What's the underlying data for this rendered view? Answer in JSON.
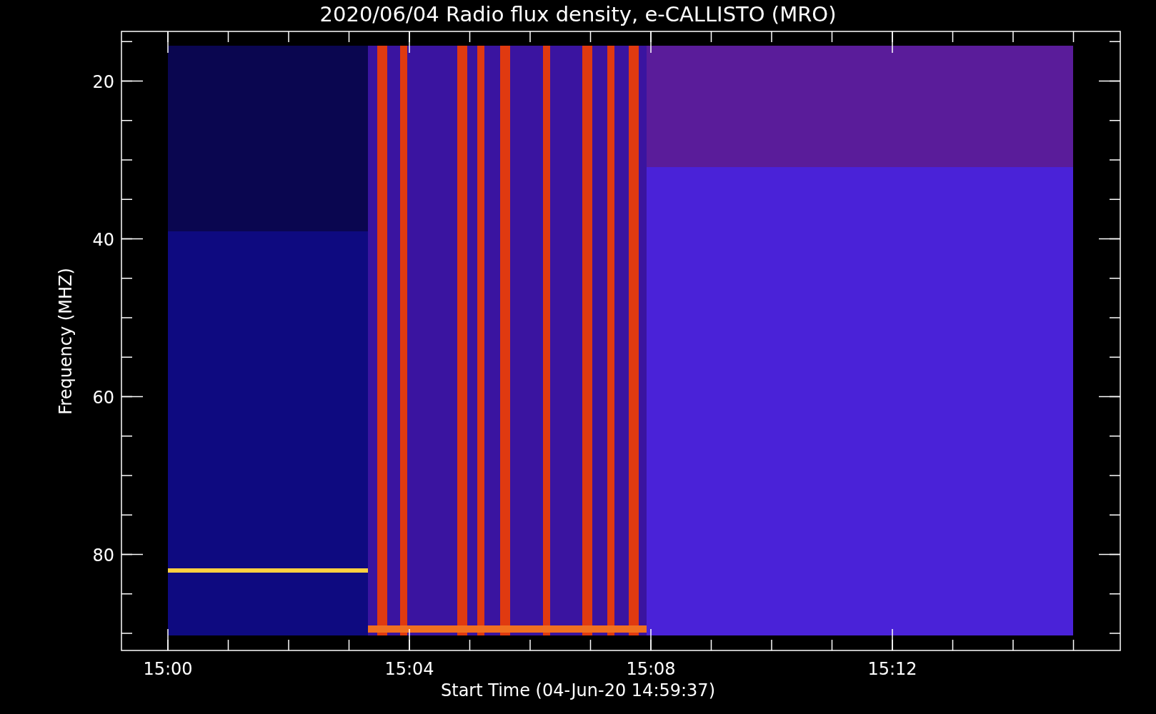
{
  "plot": {
    "title": "2020/06/04  Radio flux density, e-CALLISTO (MRO)",
    "xlabel": "Start Time (04-Jun-20 14:59:37)",
    "ylabel": "Frequency (MHZ)",
    "xtick_labels": [
      "15:00",
      "15:04",
      "15:08",
      "15:12"
    ],
    "ytick_labels": [
      "20",
      "40",
      "60",
      "80"
    ]
  }
}
